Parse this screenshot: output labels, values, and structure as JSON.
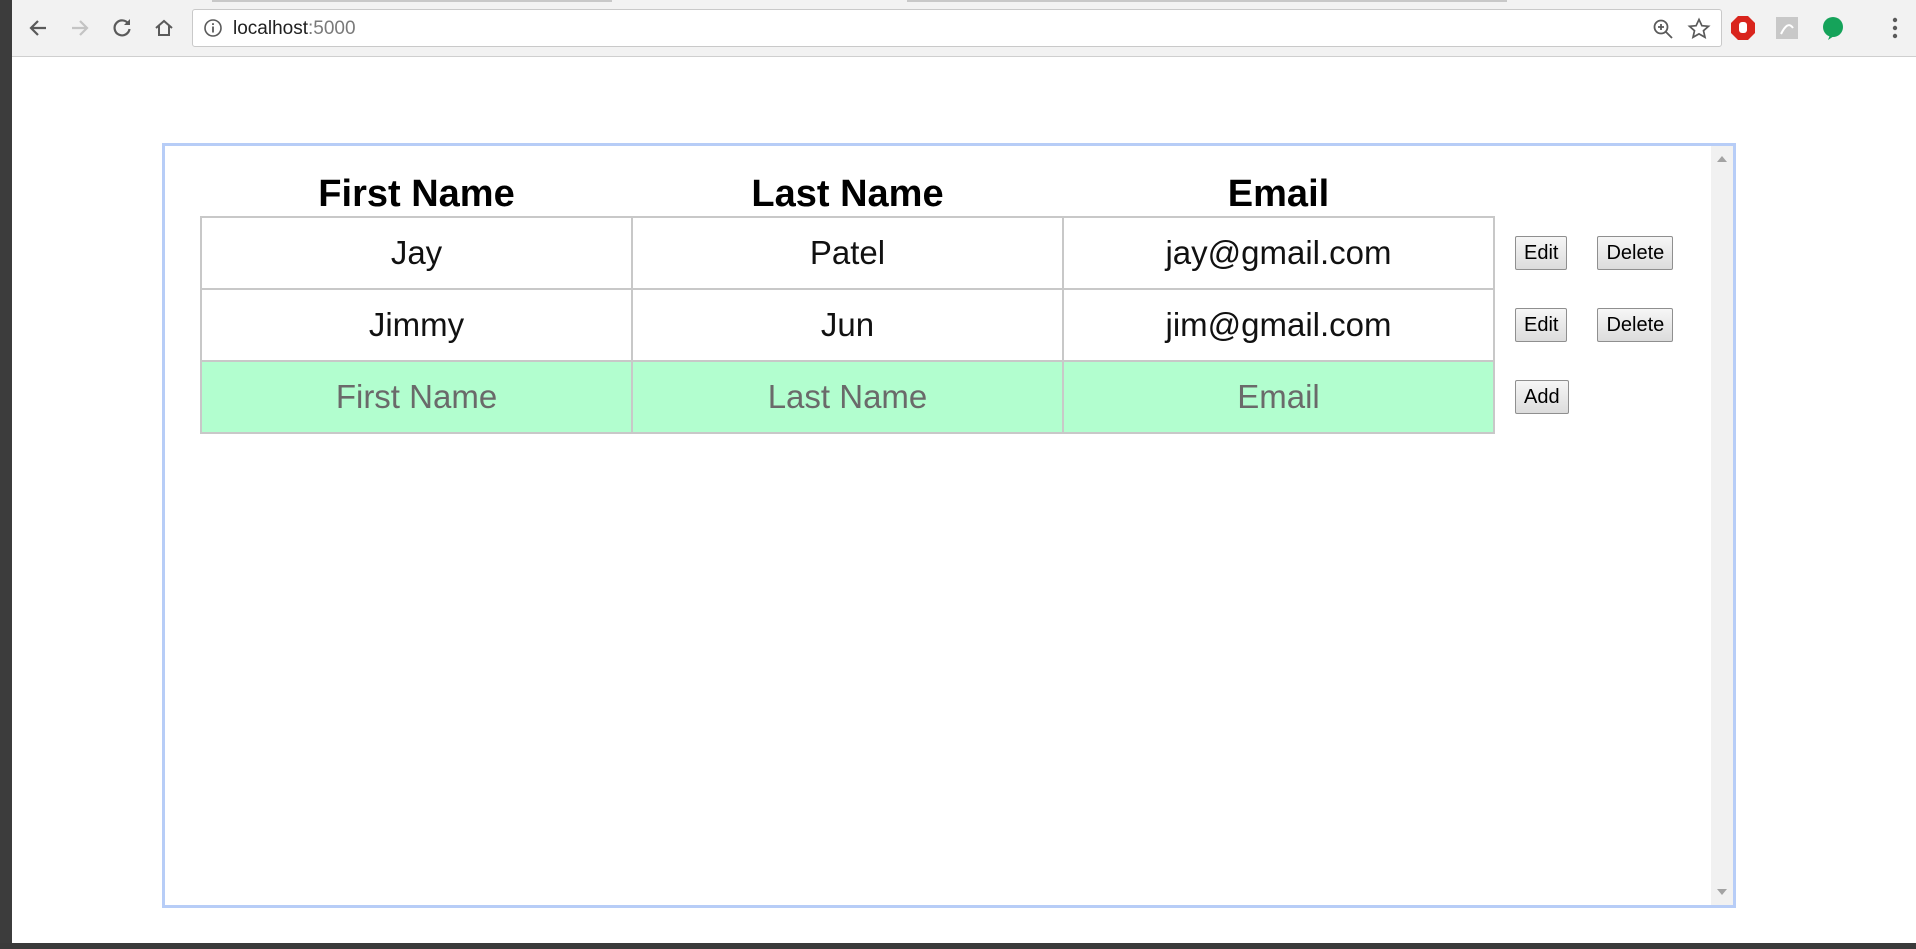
{
  "browser": {
    "url_host": "localhost",
    "url_port": ":5000",
    "icons": [
      "back-icon",
      "forward-icon",
      "reload-icon",
      "home-icon",
      "info-icon",
      "zoom-icon",
      "bookmark-star-icon",
      "adblock-icon",
      "pdf-icon",
      "green-extension-icon",
      "menu-icon"
    ]
  },
  "table": {
    "headers": {
      "first_name": "First Name",
      "last_name": "Last Name",
      "email": "Email"
    },
    "rows": [
      {
        "first_name": "Jay",
        "last_name": "Patel",
        "email": "jay@gmail.com",
        "edit_label": "Edit",
        "delete_label": "Delete"
      },
      {
        "first_name": "Jimmy",
        "last_name": "Jun",
        "email": "jim@gmail.com",
        "edit_label": "Edit",
        "delete_label": "Delete"
      }
    ],
    "add_row": {
      "first_name_placeholder": "First Name",
      "last_name_placeholder": "Last Name",
      "email_placeholder": "Email",
      "add_label": "Add",
      "background": "#b2fecf"
    }
  },
  "colors": {
    "frame_border": "#b7cdf7"
  }
}
